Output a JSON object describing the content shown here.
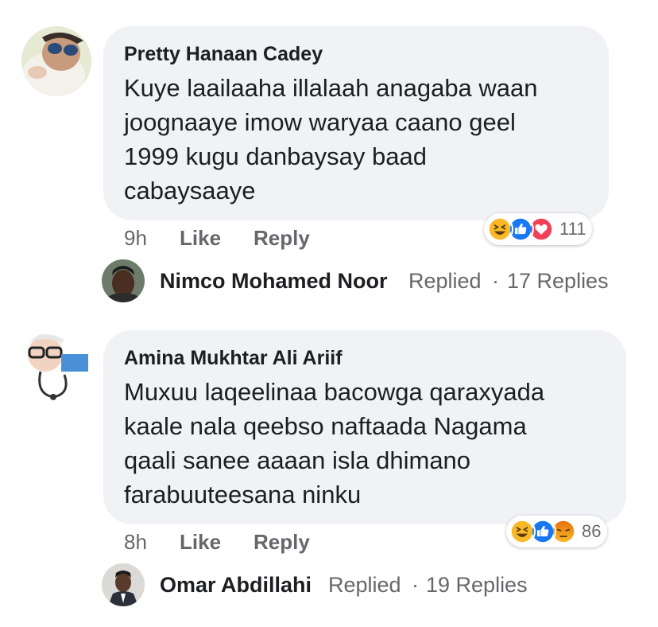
{
  "comments": [
    {
      "author": "Pretty Hanaan Cadey",
      "lines": [
        "Kuye laailaaha illalaah anagaba waan",
        "joognaaye imow waryaa caano geel",
        "1999 kugu danbaysay baad",
        "cabaysaaye"
      ],
      "time": "9h",
      "like_label": "Like",
      "reply_label": "Reply",
      "reactions": [
        "haha-icon",
        "like-icon",
        "love-icon"
      ],
      "reaction_count": "111",
      "reply_summary": {
        "name": "Nimco Mohamed Noor",
        "replied": "Replied",
        "dot": "·",
        "count": "17 Replies"
      }
    },
    {
      "author": "Amina Mukhtar Ali Ariif",
      "lines": [
        "Muxuu laqeelinaa bacowga qaraxyada",
        "kaale nala qeebso naftaada Nagama",
        "qaali sanee aaaan isla dhimano",
        "farabuuteesana ninku"
      ],
      "time": "8h",
      "like_label": "Like",
      "reply_label": "Reply",
      "reactions": [
        "haha-icon",
        "like-icon",
        "angry-icon"
      ],
      "reaction_count": "86",
      "reply_summary": {
        "name": "Omar Abdillahi",
        "replied": "Replied",
        "dot": "·",
        "count": "19 Replies"
      }
    }
  ],
  "colors": {
    "bubble": "#f0f2f5",
    "meta": "#65676b",
    "text": "#1c1e21",
    "like_blue": "#1877f2",
    "love_red": "#f33e58",
    "haha_yellow": "#f7b928",
    "angry_orange": "#e9710f"
  }
}
